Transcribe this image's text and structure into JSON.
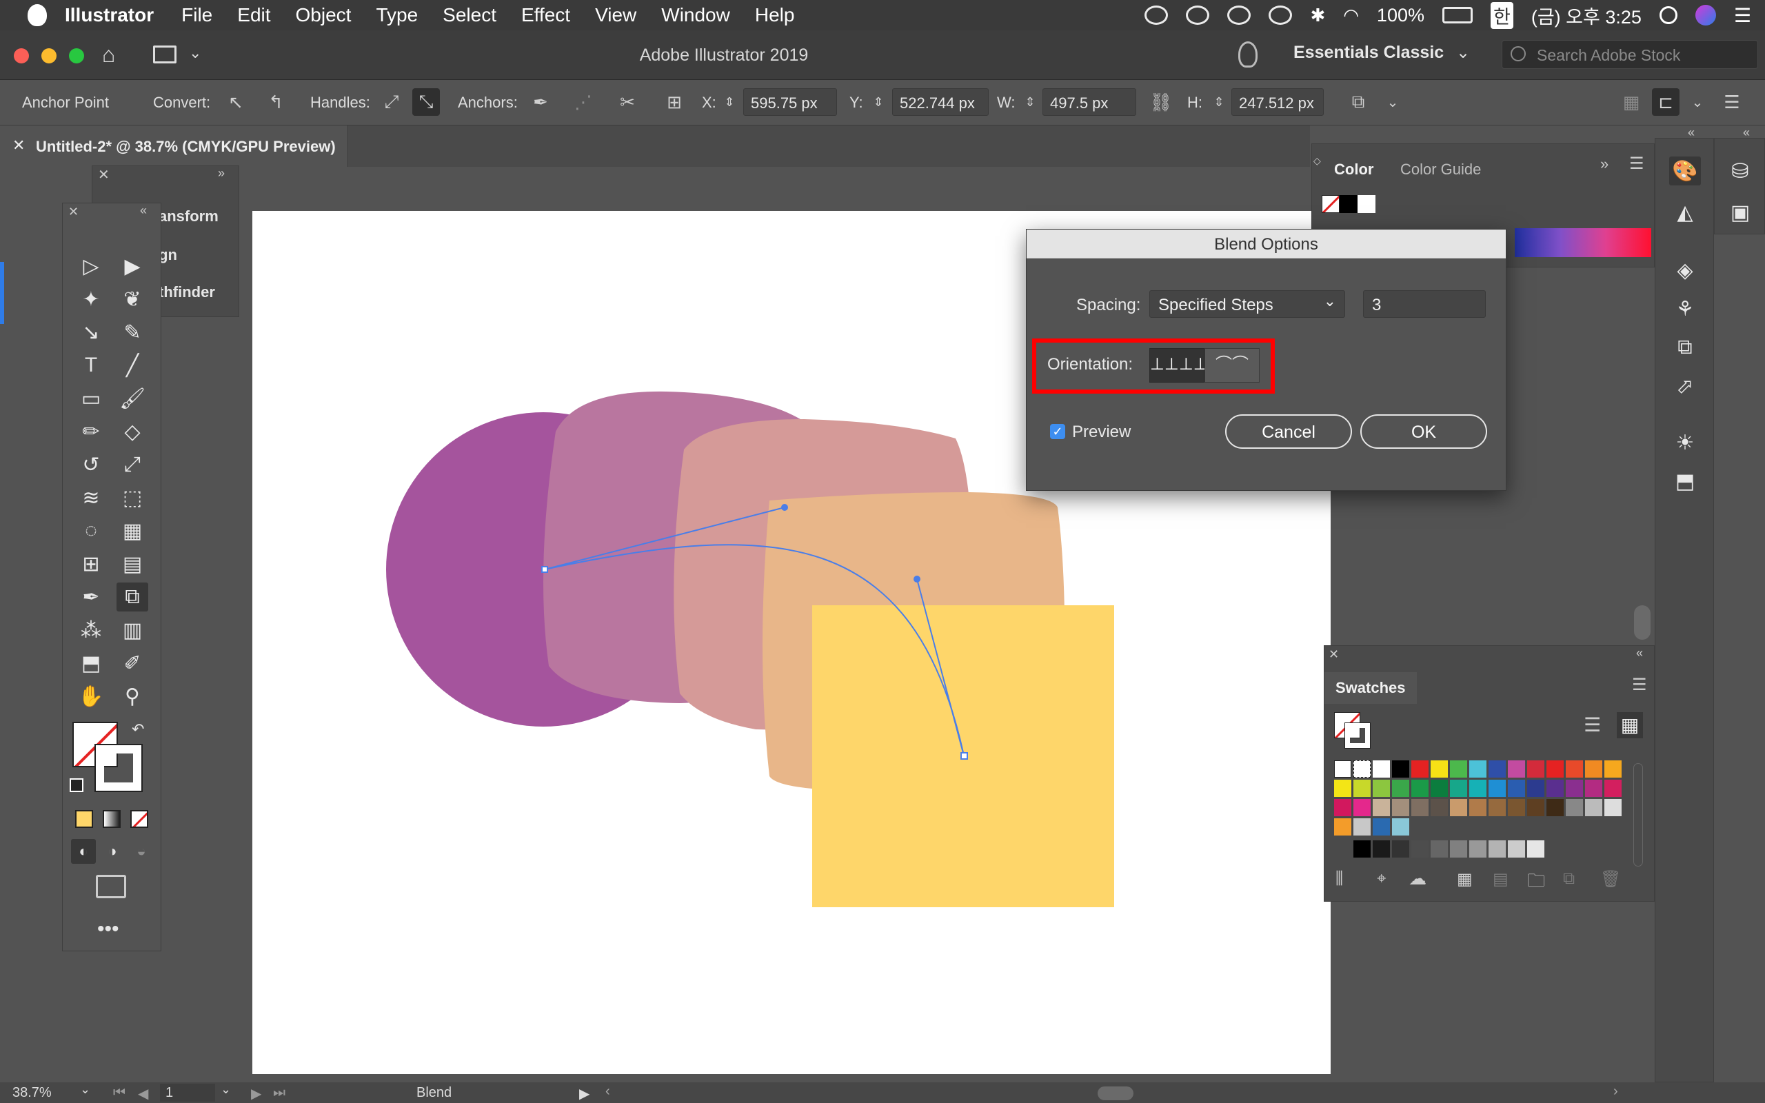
{
  "menubar": {
    "items": [
      "Illustrator",
      "File",
      "Edit",
      "Object",
      "Type",
      "Select",
      "Effect",
      "View",
      "Window",
      "Help"
    ],
    "battery": "100%",
    "input_method": "한",
    "clock": "(금) 오후 3:25"
  },
  "titlebar": {
    "title": "Adobe Illustrator 2019",
    "workspace": "Essentials Classic",
    "search_placeholder": "Search Adobe Stock"
  },
  "control_bar": {
    "selection": "Anchor Point",
    "convert_label": "Convert:",
    "handles_label": "Handles:",
    "anchors_label": "Anchors:",
    "x_label": "X:",
    "x_value": "595.75 px",
    "y_label": "Y:",
    "y_value": "522.744 px",
    "w_label": "W:",
    "w_value": "497.5 px",
    "h_label": "H:",
    "h_value": "247.512 px"
  },
  "document_tab": {
    "title": "Untitled-2* @ 38.7% (CMYK/GPU Preview)"
  },
  "mini_panel": {
    "items": [
      "ansform",
      "gn",
      "thfinder"
    ]
  },
  "color_panel": {
    "tabs": [
      "Color",
      "Color Guide"
    ]
  },
  "swatches_panel": {
    "title": "Swatches"
  },
  "blend_dialog": {
    "title": "Blend Options",
    "spacing_label": "Spacing:",
    "spacing_value": "Specified Steps",
    "steps_value": "3",
    "orientation_label": "Orientation:",
    "preview_label": "Preview",
    "preview_checked": true,
    "cancel_label": "Cancel",
    "ok_label": "OK"
  },
  "status_bar": {
    "zoom": "38.7%",
    "artboard_number": "1",
    "tool_status": "Blend"
  },
  "colors": {
    "purple": "#a5549d",
    "mauve": "#b9769f",
    "pink": "#d59a98",
    "peach": "#e8b689",
    "yellow": "#fed66a",
    "highlight_red": "#ff0000",
    "path_blue": "#4a7ee8"
  }
}
